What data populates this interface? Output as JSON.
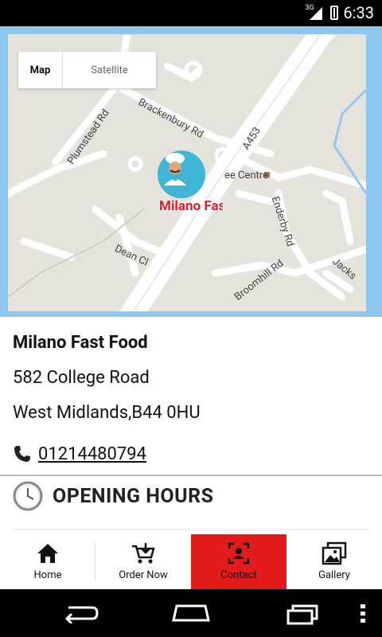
{
  "status_bar": {
    "network": "3G",
    "time": "6:33"
  },
  "map": {
    "type_control": {
      "map": "Map",
      "satellite": "Satellite"
    },
    "road_labels": [
      "Plumstead Rd",
      "Brackenbury Rd",
      "A453",
      "ee Centre",
      "Enderby Rd",
      "Dean Cl",
      "Broomhill Rd",
      "Jacks"
    ],
    "marker_label": "Milano Fast Food"
  },
  "business": {
    "name": "Milano Fast Food",
    "address_line1": "582 College Road",
    "address_line2": "West Midlands,B44 0HU",
    "phone": "01214480794"
  },
  "opening_hours": {
    "title": "OPENING HOURS"
  },
  "bottom_nav": [
    {
      "label": "Home",
      "icon": "home-icon"
    },
    {
      "label": "Order Now",
      "icon": "cart-icon"
    },
    {
      "label": "Contact",
      "icon": "contact-icon",
      "active": true
    },
    {
      "label": "Gallery",
      "icon": "gallery-icon"
    }
  ],
  "colors": {
    "accent": "#e21b1c",
    "map_border": "#8ec7ee",
    "marker": "#3fb6d6"
  }
}
